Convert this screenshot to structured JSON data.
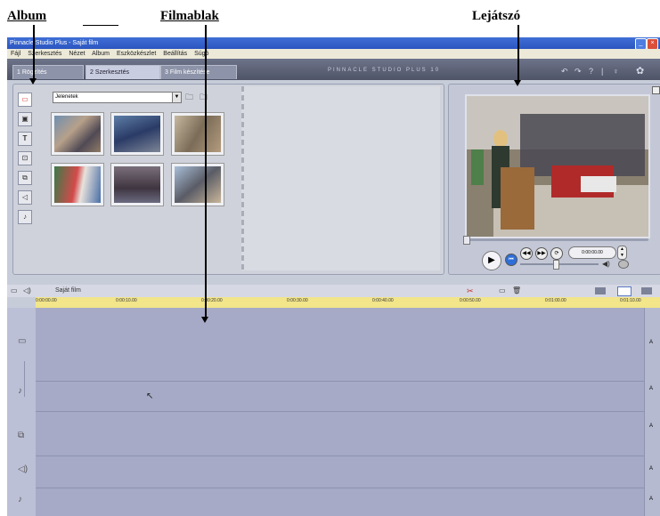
{
  "annotations": {
    "album": "Album",
    "filmablak": "Filmablak",
    "lejatszo": "Lejátszó"
  },
  "window": {
    "title": "Pinnacle Studio Plus - Saját film",
    "menu": [
      "Fájl",
      "Szerkesztés",
      "Nézet",
      "Album",
      "Eszközkészlet",
      "Beállítás",
      "Súgó"
    ]
  },
  "tabs": [
    {
      "label": "1 Rögzítés"
    },
    {
      "label": "2 Szerkesztés"
    },
    {
      "label": "3 Film készítése"
    }
  ],
  "brand": "PINNACLE STUDIO PLUS 10",
  "album": {
    "dropdown_value": "Jelenetek"
  },
  "timeline": {
    "title": "Saját film",
    "timecodes": [
      "0:00:00.00",
      "0:00:10.00",
      "0:00:20.00",
      "0:00:30.00",
      "0:00:40.00",
      "0:00:50.00",
      "0:01:00.00",
      "0:01:10.00"
    ]
  },
  "player": {
    "counter": "0:00:00.00"
  },
  "colors": {
    "titlebar": "#2c55c0",
    "ruler": "#f2e58a",
    "timeline": "#a6aac6"
  }
}
